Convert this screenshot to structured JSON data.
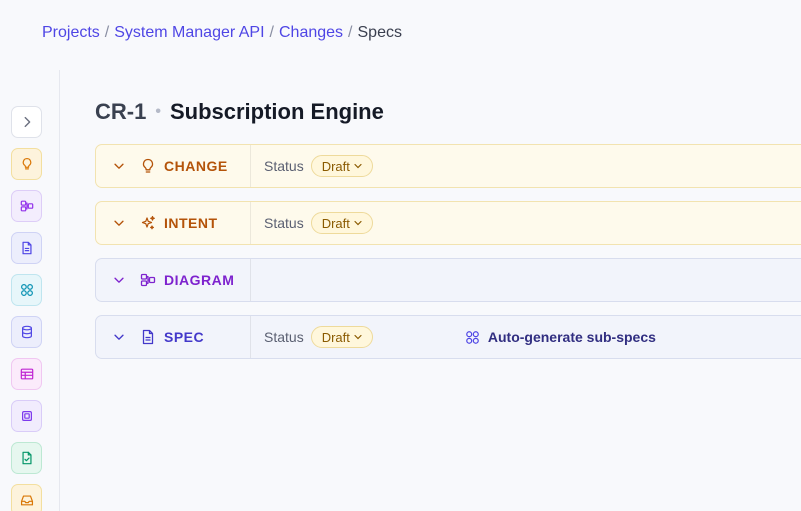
{
  "breadcrumb": {
    "items": [
      "Projects",
      "System Manager API",
      "Changes"
    ],
    "separator": "/",
    "current": "Specs"
  },
  "title": {
    "id": "CR-1",
    "separator": "•",
    "name": "Subscription Engine"
  },
  "sidebar": {
    "items": [
      {
        "icon": "chevron-right-icon"
      },
      {
        "icon": "lightbulb-icon",
        "color": "#d97706",
        "bg": "#fdf3dc",
        "border": "#f3df9f"
      },
      {
        "icon": "diagram-icon",
        "color": "#9333ea",
        "bg": "#f3edfd",
        "border": "#ddcdf7"
      },
      {
        "icon": "document-icon",
        "color": "#4f46e5",
        "bg": "#eceefc",
        "border": "#cfd3f5"
      },
      {
        "icon": "grid-icon",
        "color": "#0891b2",
        "bg": "#e7f6fa",
        "border": "#bfe5ef"
      },
      {
        "icon": "database-icon",
        "color": "#4f46e5",
        "bg": "#eceefc",
        "border": "#cfd3f5"
      },
      {
        "icon": "table-icon",
        "color": "#c026d3",
        "bg": "#fbebfb",
        "border": "#f0c7f1"
      },
      {
        "icon": "chip-icon",
        "color": "#7c3aed",
        "bg": "#f1ecfd",
        "border": "#d9ccf8"
      },
      {
        "icon": "file-check-icon",
        "color": "#059669",
        "bg": "#e6f7ef",
        "border": "#bde8d3"
      },
      {
        "icon": "inbox-icon",
        "color": "#d97706",
        "bg": "#fdf3dc",
        "border": "#f3df9f"
      }
    ]
  },
  "sections": [
    {
      "label": "CHANGE",
      "icon": "lightbulb-icon",
      "color": "#b45309",
      "status_label": "Status",
      "status": "Draft"
    },
    {
      "label": "INTENT",
      "icon": "sparkles-icon",
      "color": "#b45309",
      "status_label": "Status",
      "status": "Draft"
    },
    {
      "label": "DIAGRAM",
      "icon": "diagram-icon",
      "color": "#7e22ce"
    },
    {
      "label": "SPEC",
      "icon": "document-icon",
      "color": "#4338ca",
      "status_label": "Status",
      "status": "Draft",
      "action": "Auto-generate sub-specs"
    }
  ]
}
